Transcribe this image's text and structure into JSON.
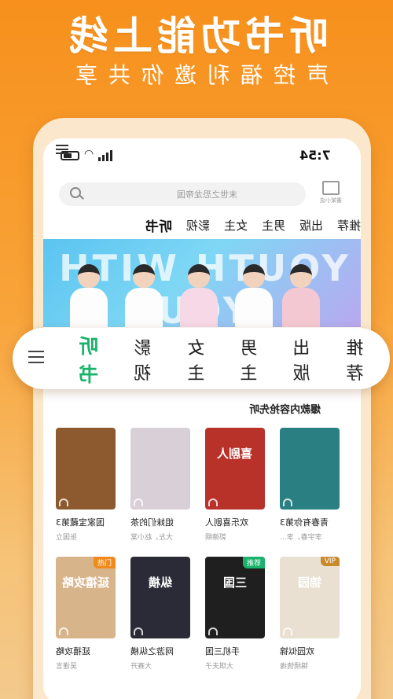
{
  "promo": {
    "headline": "听书功能上线",
    "subline": "声控福利邀你共享"
  },
  "status": {
    "time": "7:54"
  },
  "search": {
    "placeholder": "末世之恐龙帝国"
  },
  "shelf": {
    "caption": "書架小说"
  },
  "tabs": [
    "推荐",
    "出版",
    "男主",
    "女主",
    "影视",
    "听书"
  ],
  "active_tab": "听书",
  "banner": {
    "text": "YOUTH WITH YOU"
  },
  "section_title": "爆款内容抢先听",
  "books": [
    {
      "title": "青春有你第3",
      "author": "李宇春，李...",
      "badge": "",
      "color": "#2a7f83"
    },
    {
      "title": "欢乐喜剧人",
      "author": "郭德纲",
      "badge": "",
      "color": "#b8322a",
      "art": "喜剧人"
    },
    {
      "title": "姐妹们的茶",
      "author": "大左，赵小棠",
      "badge": "",
      "color": "#d9cfd6"
    },
    {
      "title": "国家宝藏第3",
      "author": "张国立",
      "badge": "",
      "color": "#8c5a2e"
    },
    {
      "title": "欢园似锦",
      "author": "锦绣情缘",
      "badge": "VIP",
      "badge_color": "#c78b2e",
      "color": "#e9e0d2",
      "art": "锦园"
    },
    {
      "title": "手机三国",
      "author": "大琪夫子",
      "badge": "推荐",
      "badge_color": "#19b36b",
      "color": "#1f1f1f",
      "art": "三国"
    },
    {
      "title": "网游之纵横",
      "author": "大赛开",
      "badge": "",
      "color": "#2b2b38",
      "art": "纵横"
    },
    {
      "title": "延禧攻略",
      "author": "吴谨言",
      "badge": "热门",
      "badge_color": "#f08a1c",
      "color": "#d8b48a",
      "art": "延禧攻略"
    }
  ]
}
